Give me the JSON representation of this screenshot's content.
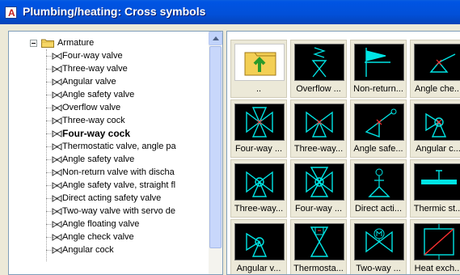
{
  "window": {
    "title": "Plumbing/heating: Cross symbols"
  },
  "tree": {
    "folder_label": "Armature",
    "items": [
      "Four-way valve",
      "Three-way valve",
      "Angular valve",
      "Angle safety valve",
      "Overflow valve",
      "Three-way cock",
      "Four-way cock",
      "Thermostatic valve, angle pa",
      "Angle safety valve",
      "Non-return valve with discha",
      "Angle safety valve, straight fl",
      "Direct acting safety valve",
      "Two-way valve with servo de",
      "Angle floating valve",
      "Angle check valve",
      "Angular cock"
    ],
    "selected_index": 6
  },
  "grid": {
    "tiles": [
      {
        "caption": "..",
        "icon": "folder-up-icon"
      },
      {
        "caption": "Overflow ...",
        "icon": "overflow-valve-icon"
      },
      {
        "caption": "Non-return...",
        "icon": "non-return-valve-icon"
      },
      {
        "caption": "Angle che...",
        "icon": "angle-check-valve-icon"
      },
      {
        "caption": "Four-way ...",
        "icon": "four-way-valve-icon"
      },
      {
        "caption": "Three-way...",
        "icon": "three-way-valve-icon"
      },
      {
        "caption": "Angle safe...",
        "icon": "angle-safety-valve-icon"
      },
      {
        "caption": "Angular c...",
        "icon": "angular-cock-icon"
      },
      {
        "caption": "Three-way...",
        "icon": "three-way-cock-icon"
      },
      {
        "caption": "Four-way ...",
        "icon": "four-way-cock-icon"
      },
      {
        "caption": "Direct acti...",
        "icon": "direct-acting-valve-icon"
      },
      {
        "caption": "Thermic st...",
        "icon": "thermic-strip-icon"
      },
      {
        "caption": "Angular v...",
        "icon": "angular-valve-icon"
      },
      {
        "caption": "Thermosta...",
        "icon": "thermostatic-valve-icon"
      },
      {
        "caption": "Two-way ...",
        "icon": "two-way-servo-valve-icon"
      },
      {
        "caption": "Heat exch...",
        "icon": "heat-exchanger-icon"
      }
    ]
  },
  "colors": {
    "symbol": "#00e5e5",
    "marker": "#ff3030",
    "titlebar": "#0054e3"
  }
}
